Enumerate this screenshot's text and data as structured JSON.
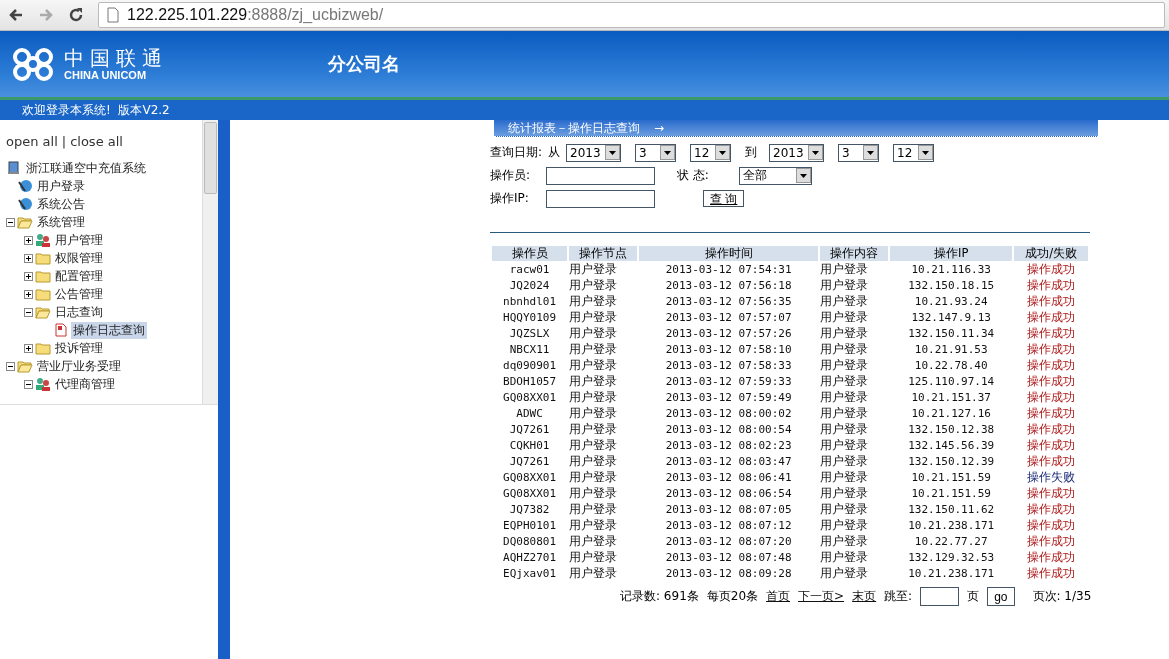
{
  "browser": {
    "url_host": "122.225.101.229",
    "url_rest": ":8888/zj_ucbizweb/"
  },
  "header": {
    "logo_cn": "中国联通",
    "logo_en": "CHINA UNICOM",
    "branch": "分公司名"
  },
  "welcome_bar": {
    "text": "欢迎登录本系统!  版本V2.2"
  },
  "sidebar": {
    "open_all": "open all",
    "separator": "|",
    "close_all": "close all",
    "tree": {
      "label": "浙江联通空中充值系统",
      "kind": "root",
      "children": [
        {
          "label": "用户登录",
          "kind": "link",
          "selected": false
        },
        {
          "label": "系统公告",
          "kind": "link",
          "selected": false
        },
        {
          "label": "系统管理",
          "kind": "folder",
          "expanded": true,
          "selected": false,
          "children": [
            {
              "label": "用户管理",
              "kind": "group",
              "expanded": false,
              "selected": false
            },
            {
              "label": "权限管理",
              "kind": "folder",
              "expanded": false,
              "selected": false
            },
            {
              "label": "配置管理",
              "kind": "folder",
              "expanded": false,
              "selected": false
            },
            {
              "label": "公告管理",
              "kind": "folder",
              "expanded": false,
              "selected": false
            },
            {
              "label": "日志查询",
              "kind": "folder",
              "expanded": true,
              "selected": false,
              "children": [
                {
                  "label": "操作日志查询",
                  "kind": "page",
                  "selected": true
                }
              ]
            },
            {
              "label": "投诉管理",
              "kind": "folder",
              "expanded": false,
              "selected": false
            }
          ]
        },
        {
          "label": "营业厅业务受理",
          "kind": "folder",
          "expanded": true,
          "selected": false,
          "children": [
            {
              "label": "代理商管理",
              "kind": "group",
              "expanded": true,
              "selected": false
            }
          ]
        }
      ]
    }
  },
  "content": {
    "title": "统计报表－操作日志查询",
    "title_arrow": "→",
    "filters": {
      "date_label": "查询日期:",
      "from": "从",
      "to": "到",
      "from_date": [
        "2013",
        "3",
        "12"
      ],
      "to_date": [
        "2013",
        "3",
        "12"
      ],
      "operator_label": "操作员:",
      "status_label": "状 态:",
      "status_value": "全部",
      "ip_label": "操作IP:",
      "query_button": "查 询"
    },
    "table": {
      "columns": [
        "操作员",
        "操作节点",
        "操作时间",
        "操作内容",
        "操作IP",
        "成功/失败"
      ],
      "rows": [
        {
          "cells": [
            "racw01",
            "用户登录",
            "2013-03-12 07:54:31",
            "用户登录",
            "10.21.116.33",
            "操作成功"
          ],
          "success": true
        },
        {
          "cells": [
            "JQ2024",
            "用户登录",
            "2013-03-12 07:56:18",
            "用户登录",
            "132.150.18.15",
            "操作成功"
          ],
          "success": true
        },
        {
          "cells": [
            "nbnhdl01",
            "用户登录",
            "2013-03-12 07:56:35",
            "用户登录",
            "10.21.93.24",
            "操作成功"
          ],
          "success": true
        },
        {
          "cells": [
            "HQQY0109",
            "用户登录",
            "2013-03-12 07:57:07",
            "用户登录",
            "132.147.9.13",
            "操作成功"
          ],
          "success": true
        },
        {
          "cells": [
            "JQZSLX",
            "用户登录",
            "2013-03-12 07:57:26",
            "用户登录",
            "132.150.11.34",
            "操作成功"
          ],
          "success": true
        },
        {
          "cells": [
            "NBCX11",
            "用户登录",
            "2013-03-12 07:58:10",
            "用户登录",
            "10.21.91.53",
            "操作成功"
          ],
          "success": true
        },
        {
          "cells": [
            "dq090901",
            "用户登录",
            "2013-03-12 07:58:33",
            "用户登录",
            "10.22.78.40",
            "操作成功"
          ],
          "success": true
        },
        {
          "cells": [
            "BDOH1057",
            "用户登录",
            "2013-03-12 07:59:33",
            "用户登录",
            "125.110.97.14",
            "操作成功"
          ],
          "success": true
        },
        {
          "cells": [
            "GQ08XX01",
            "用户登录",
            "2013-03-12 07:59:49",
            "用户登录",
            "10.21.151.37",
            "操作成功"
          ],
          "success": true
        },
        {
          "cells": [
            "ADWC",
            "用户登录",
            "2013-03-12 08:00:02",
            "用户登录",
            "10.21.127.16",
            "操作成功"
          ],
          "success": true
        },
        {
          "cells": [
            "JQ7261",
            "用户登录",
            "2013-03-12 08:00:54",
            "用户登录",
            "132.150.12.38",
            "操作成功"
          ],
          "success": true
        },
        {
          "cells": [
            "CQKH01",
            "用户登录",
            "2013-03-12 08:02:23",
            "用户登录",
            "132.145.56.39",
            "操作成功"
          ],
          "success": true
        },
        {
          "cells": [
            "JQ7261",
            "用户登录",
            "2013-03-12 08:03:47",
            "用户登录",
            "132.150.12.39",
            "操作成功"
          ],
          "success": true
        },
        {
          "cells": [
            "GQ08XX01",
            "用户登录",
            "2013-03-12 08:06:41",
            "用户登录",
            "10.21.151.59",
            "操作失败"
          ],
          "success": false
        },
        {
          "cells": [
            "GQ08XX01",
            "用户登录",
            "2013-03-12 08:06:54",
            "用户登录",
            "10.21.151.59",
            "操作成功"
          ],
          "success": true
        },
        {
          "cells": [
            "JQ7382",
            "用户登录",
            "2013-03-12 08:07:05",
            "用户登录",
            "132.150.11.62",
            "操作成功"
          ],
          "success": true
        },
        {
          "cells": [
            "EQPH0101",
            "用户登录",
            "2013-03-12 08:07:12",
            "用户登录",
            "10.21.238.171",
            "操作成功"
          ],
          "success": true
        },
        {
          "cells": [
            "DQ080801",
            "用户登录",
            "2013-03-12 08:07:20",
            "用户登录",
            "10.22.77.27",
            "操作成功"
          ],
          "success": true
        },
        {
          "cells": [
            "AQHZ2701",
            "用户登录",
            "2013-03-12 08:07:48",
            "用户登录",
            "132.129.32.53",
            "操作成功"
          ],
          "success": true
        },
        {
          "cells": [
            "EQjxav01",
            "用户登录",
            "2013-03-12 08:09:28",
            "用户登录",
            "10.21.238.171",
            "操作成功"
          ],
          "success": true
        }
      ]
    },
    "pager": {
      "records": "记录数: 691条",
      "per_page": "每页20条",
      "first": "首页",
      "next": "下一页>",
      "last": "末页",
      "jump_label": "跳至:",
      "page_unit": "页",
      "go": "go",
      "page_info": "页次: 1/35"
    }
  }
}
